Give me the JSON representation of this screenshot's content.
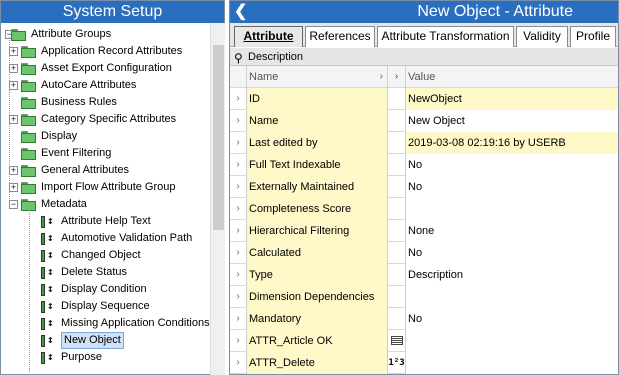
{
  "left": {
    "title": "System Setup",
    "tree": [
      {
        "label": "Attribute Groups",
        "kind": "folder",
        "depth": 0,
        "expander": "minus"
      },
      {
        "label": "Application Record Attributes",
        "kind": "folder",
        "depth": 1,
        "expander": "plus"
      },
      {
        "label": "Asset Export Configuration",
        "kind": "folder",
        "depth": 1,
        "expander": "plus"
      },
      {
        "label": "AutoCare Attributes",
        "kind": "folder",
        "depth": 1,
        "expander": "plus"
      },
      {
        "label": "Business Rules",
        "kind": "folder",
        "depth": 1,
        "expander": "none"
      },
      {
        "label": "Category Specific Attributes",
        "kind": "folder",
        "depth": 1,
        "expander": "plus"
      },
      {
        "label": "Display",
        "kind": "folder",
        "depth": 1,
        "expander": "none"
      },
      {
        "label": "Event Filtering",
        "kind": "folder",
        "depth": 1,
        "expander": "none"
      },
      {
        "label": "General Attributes",
        "kind": "folder",
        "depth": 1,
        "expander": "plus"
      },
      {
        "label": "Import Flow Attribute Group",
        "kind": "folder",
        "depth": 1,
        "expander": "plus"
      },
      {
        "label": "Metadata",
        "kind": "folder",
        "depth": 1,
        "expander": "minus"
      },
      {
        "label": "Attribute Help Text",
        "kind": "attr",
        "depth": 2,
        "expander": "none"
      },
      {
        "label": "Automotive Validation Path",
        "kind": "attr",
        "depth": 2,
        "expander": "none"
      },
      {
        "label": "Changed Object",
        "kind": "attr",
        "depth": 2,
        "expander": "none"
      },
      {
        "label": "Delete Status",
        "kind": "attr",
        "depth": 2,
        "expander": "none"
      },
      {
        "label": "Display Condition",
        "kind": "attr",
        "depth": 2,
        "expander": "none"
      },
      {
        "label": "Display Sequence",
        "kind": "attr",
        "depth": 2,
        "expander": "none"
      },
      {
        "label": "Missing Application Conditions",
        "kind": "attr",
        "depth": 2,
        "expander": "none"
      },
      {
        "label": "New Object",
        "kind": "attr",
        "depth": 2,
        "expander": "none",
        "selected": true
      },
      {
        "label": "Purpose",
        "kind": "attr",
        "depth": 2,
        "expander": "none"
      }
    ]
  },
  "right": {
    "title": "New Object - Attribute",
    "back_icon": "chevron-left-icon",
    "tabs": [
      "Attribute",
      "References",
      "Attribute Transformation",
      "Validity",
      "Profile"
    ],
    "active_tab": 0,
    "section": "Description",
    "columns": {
      "name": "Name",
      "value": "Value"
    },
    "rows": [
      {
        "name": "ID",
        "value": "NewObject",
        "value_bg": "yellow",
        "flag": ""
      },
      {
        "name": "Name",
        "value": "New Object",
        "value_bg": "white",
        "flag": ""
      },
      {
        "name": "Last edited by",
        "value": "2019-03-08 02:19:16 by USERB",
        "value_bg": "yellow",
        "flag": ""
      },
      {
        "name": "Full Text Indexable",
        "value": "No",
        "value_bg": "white",
        "flag": ""
      },
      {
        "name": "Externally Maintained",
        "value": "No",
        "value_bg": "white",
        "flag": ""
      },
      {
        "name": "Completeness Score",
        "value": "",
        "value_bg": "white",
        "flag": ""
      },
      {
        "name": "Hierarchical Filtering",
        "value": "None",
        "value_bg": "white",
        "flag": ""
      },
      {
        "name": "Calculated",
        "value": "No",
        "value_bg": "white",
        "flag": ""
      },
      {
        "name": "Type",
        "value": "Description",
        "value_bg": "white",
        "flag": ""
      },
      {
        "name": "Dimension Dependencies",
        "value": "",
        "value_bg": "white",
        "flag": ""
      },
      {
        "name": "Mandatory",
        "value": "No",
        "value_bg": "white",
        "flag": ""
      },
      {
        "name": "ATTR_Article OK",
        "value": "",
        "value_bg": "white",
        "flag": "list"
      },
      {
        "name": "ATTR_Delete",
        "value": "",
        "value_bg": "white",
        "flag": "num"
      }
    ]
  },
  "colors": {
    "header_blue": "#2a6fbf",
    "yellow_cell": "#fff8c8",
    "selection": "#cfe2f7"
  }
}
